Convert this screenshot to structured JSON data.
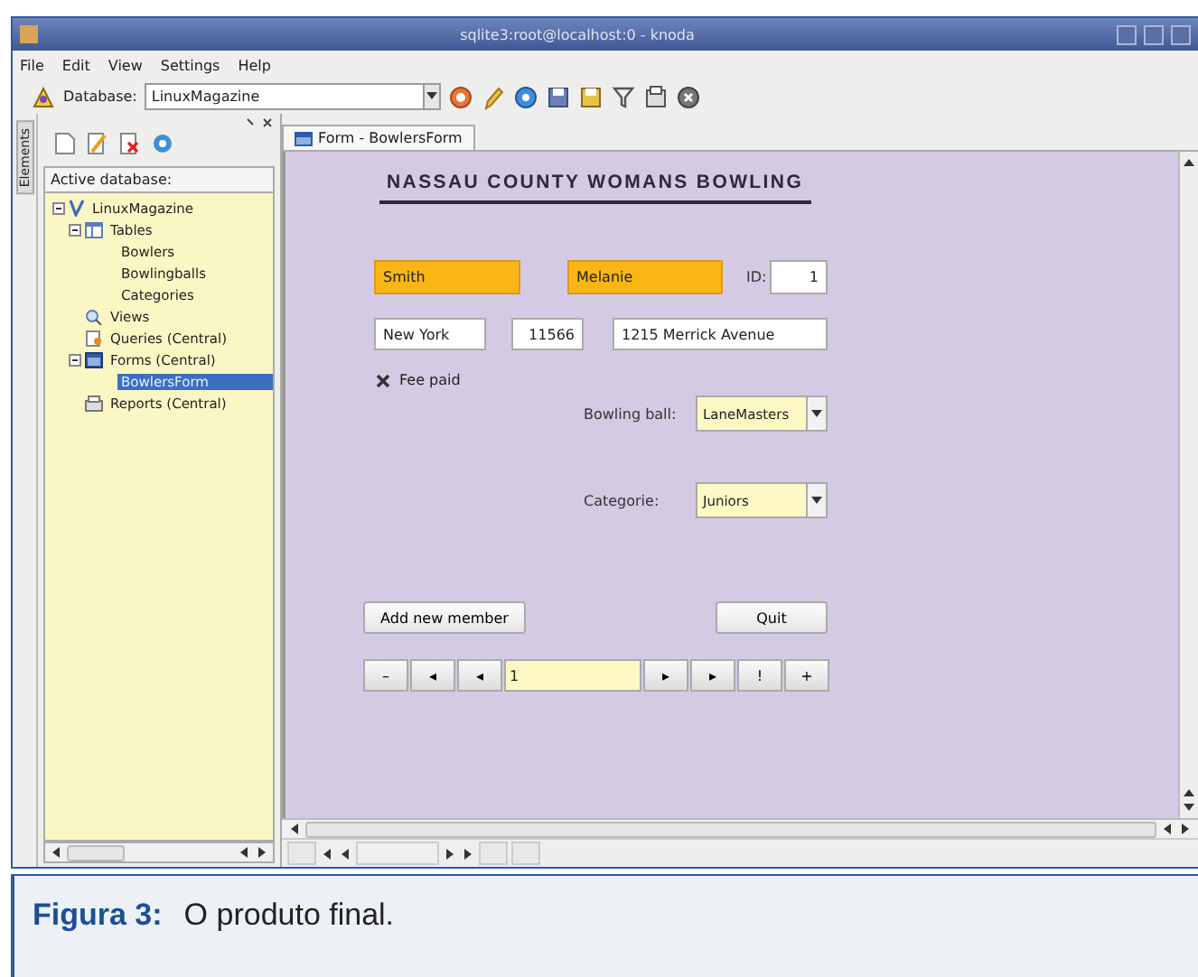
{
  "window": {
    "title": "sqlite3:root@localhost:0 - knoda"
  },
  "menu": [
    {
      "label": "File"
    },
    {
      "label": "Edit"
    },
    {
      "label": "View"
    },
    {
      "label": "Settings"
    },
    {
      "label": "Help"
    }
  ],
  "toolbar": {
    "database_label": "Database:",
    "database_value": "LinuxMagazine"
  },
  "sidebar": {
    "tab": "Elements",
    "header": "Active database:",
    "tree": [
      {
        "label": "LinuxMagazine",
        "kind": "database",
        "selected": false,
        "expanded": true,
        "children": [
          {
            "label": "Tables",
            "kind": "tables",
            "selected": false,
            "expanded": true,
            "children": [
              {
                "label": "Bowlers",
                "selected": false
              },
              {
                "label": "Bowlingballs",
                "selected": false
              },
              {
                "label": "Categories",
                "selected": false
              }
            ]
          },
          {
            "label": "Views",
            "kind": "views",
            "selected": false
          },
          {
            "label": "Queries (Central)",
            "kind": "queries",
            "selected": false
          },
          {
            "label": "Forms (Central)",
            "kind": "forms",
            "selected": false,
            "expanded": true,
            "children": [
              {
                "label": "BowlersForm",
                "selected": true
              }
            ]
          },
          {
            "label": "Reports (Central)",
            "kind": "reports",
            "selected": false
          }
        ]
      }
    ]
  },
  "document_tabs": [
    {
      "label": "Form - BowlersForm",
      "selected": true
    }
  ],
  "form": {
    "heading": "NASSAU COUNTY WOMANS BOWLING",
    "fields": [
      {
        "value": "Smith",
        "highlighted": true
      },
      {
        "value": "Melanie",
        "highlighted": true
      },
      {
        "value": "1",
        "highlighted": false
      },
      {
        "value": "New York",
        "highlighted": false
      },
      {
        "value": "11566",
        "highlighted": false
      },
      {
        "value": "1215 Merrick Avenue",
        "highlighted": false
      }
    ],
    "id_label": "ID:",
    "fee_paid": {
      "label": "Fee paid",
      "checked": true
    },
    "bowling_ball": {
      "label": "Bowling ball:",
      "value": "LaneMasters"
    },
    "category": {
      "label": "Categorie:",
      "value": "Juniors"
    },
    "buttons": [
      {
        "label": "Add new member"
      },
      {
        "label": "Quit"
      }
    ],
    "navigator": {
      "buttons": [
        "–",
        "◂",
        "◂",
        "▸",
        "▸",
        "!",
        "+"
      ],
      "record": "1"
    }
  },
  "caption": {
    "label": "Figura 3:",
    "text": "O produto final."
  }
}
